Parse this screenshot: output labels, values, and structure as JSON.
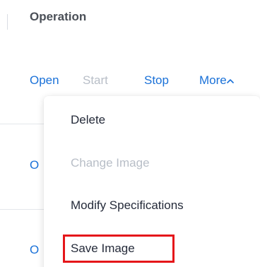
{
  "table": {
    "column_header": "Operation",
    "row_actions": {
      "open": "Open",
      "start": "Start",
      "stop": "Stop",
      "more": "More"
    },
    "partial_row_links": [
      "O",
      "O"
    ]
  },
  "more_menu": {
    "items": [
      {
        "label": "Delete",
        "disabled": false
      },
      {
        "label": "Change Image",
        "disabled": true
      },
      {
        "label": "Modify Specifications",
        "disabled": false
      },
      {
        "label": "Save Image",
        "disabled": false,
        "highlighted": true
      }
    ]
  },
  "icons": {
    "more_chevron": "chevron-up-icon"
  },
  "colors": {
    "link": "#1a71d8",
    "disabled": "#b8bec7",
    "text": "#252b3a",
    "header": "#4a4f57",
    "highlight_border": "#e5161a"
  }
}
